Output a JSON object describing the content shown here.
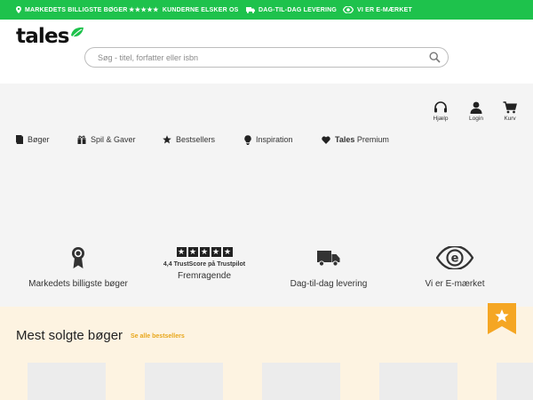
{
  "topbar": {
    "item1": "MARKEDETS BILLIGSTE BØGER",
    "item2_stars": "★★★★★",
    "item2": "KUNDERNE ELSKER OS",
    "item3": "DAG-TIL-DAG LEVERING",
    "item4": "VI ER E-MÆRKET",
    "bg_color": "#1ec24c"
  },
  "header": {
    "logo_text": "tales",
    "search_placeholder": "Søg - titel, forfatter eller isbn"
  },
  "utility": {
    "help": "Hjælp",
    "login": "Login",
    "cart": "Kurv"
  },
  "nav": {
    "books": "Bøger",
    "games": "Spil & Gaver",
    "bestsellers": "Bestsellers",
    "inspiration": "Inspiration",
    "premium_bold": "Tales",
    "premium": "Premium"
  },
  "features": {
    "cheapest": "Markedets billigste bøger",
    "trustpilot_score": "4,4 TrustScore på Trustpilot",
    "trustpilot_label": "Fremragende",
    "delivery": "Dag-til-dag levering",
    "emark": "Vi er E-mærket"
  },
  "bestsellers": {
    "title": "Mest solgte bøger",
    "see_all": "Se alle bestsellers",
    "accent_color": "#e8a61a"
  }
}
